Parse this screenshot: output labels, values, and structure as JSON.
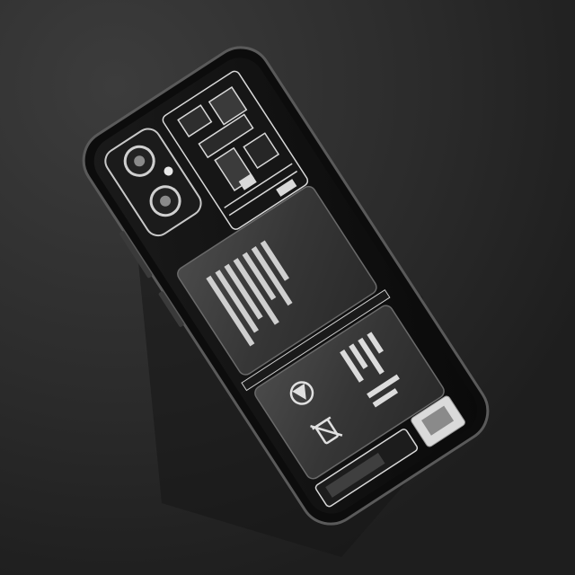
{
  "image": {
    "subject": "transparent-back-smartphone-photo"
  },
  "colors": {
    "background": "#2b2b2b",
    "background_highlight": "#3c3c3c",
    "phone_frame": "#101010",
    "phone_edge": "#5a5a5a",
    "battery": "#3a3a3a",
    "circuit": "#d9d9d9",
    "camera_module": "#c8c8c8"
  }
}
